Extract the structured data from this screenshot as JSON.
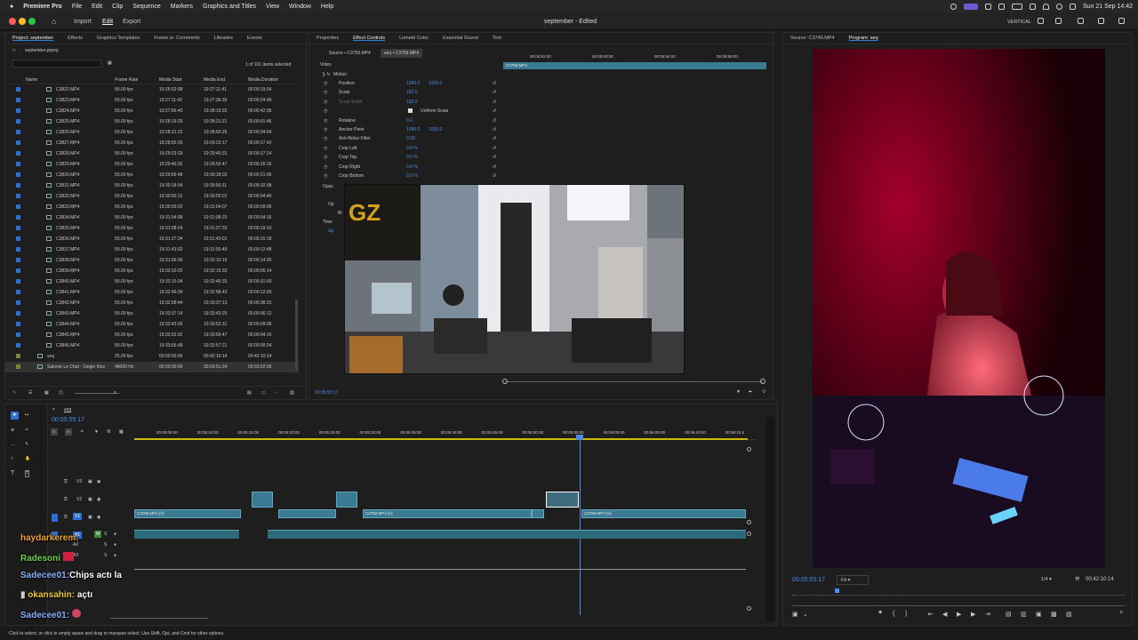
{
  "menubar": {
    "app": "Premiere Pro",
    "items": [
      "File",
      "Edit",
      "Clip",
      "Sequence",
      "Markers",
      "Graphics and Titles",
      "View",
      "Window",
      "Help"
    ],
    "clock": "Sun 21 Sep  14:42"
  },
  "titlebar": {
    "nav": [
      "Import",
      "Edit",
      "Export"
    ],
    "title": "september - Edited",
    "workspace": "VERTICAL"
  },
  "project": {
    "tabs": [
      "Project: september",
      "Effects",
      "Graphics Templates",
      "Frame.io: Comments",
      "Libraries",
      "Events"
    ],
    "filename": "september.prproj",
    "selection_count": "1 of 101 items selected",
    "columns": [
      "Name",
      "Frame Rate",
      "Media Start",
      "Media End",
      "Media Duration"
    ],
    "rows": [
      [
        "C3822.MP4",
        "50.00 fps",
        "19:26:52:08",
        "19:27:11:41",
        "00:00:19:34"
      ],
      [
        "C3823.MP4",
        "50.00 fps",
        "19:27:11:42",
        "19:27:36:39",
        "00:00:24:48"
      ],
      [
        "C3824.MP4",
        "50.00 fps",
        "19:27:56:40",
        "19:28:19:25",
        "00:00:42:36"
      ],
      [
        "C3825.MP4",
        "50.00 fps",
        "19:28:19:26",
        "19:28:21:21",
        "00:00:01:46"
      ],
      [
        "C3826.MP4",
        "50.00 fps",
        "19:28:21:22",
        "19:28:55:25",
        "00:00:34:04"
      ],
      [
        "C3827.MP4",
        "50.00 fps",
        "19:28:55:26",
        "19:29:23:17",
        "00:00:27:42"
      ],
      [
        "C3828.MP4",
        "50.00 fps",
        "19:29:23:18",
        "19:29:40:31",
        "00:00:17:14"
      ],
      [
        "C3829.MP4",
        "50.00 fps",
        "19:29:40:32",
        "19:29:56:47",
        "00:00:16:16"
      ],
      [
        "C3830.MP4",
        "50.00 fps",
        "19:29:56:48",
        "19:30:18:03",
        "00:00:21:06"
      ],
      [
        "C3831.MP4",
        "50.00 fps",
        "19:30:18:04",
        "19:30:50:11",
        "00:00:32:08"
      ],
      [
        "C3832.MP4",
        "50.00 fps",
        "19:30:50:12",
        "19:30:55:01",
        "00:00:04:40"
      ],
      [
        "C3833.MP4",
        "50.00 fps",
        "19:30:55:02",
        "19:31:04:07",
        "00:00:09:06"
      ],
      [
        "C3834.MP4",
        "50.00 fps",
        "19:31:04:08",
        "19:31:08:23",
        "00:00:04:16"
      ],
      [
        "C3835.MP4",
        "50.00 fps",
        "19:31:08:24",
        "19:31:27:33",
        "00:00:19:10"
      ],
      [
        "C3836.MP4",
        "50.00 fps",
        "19:31:27:34",
        "19:31:43:01",
        "00:00:15:18"
      ],
      [
        "C3837.MP4",
        "50.00 fps",
        "19:31:43:02",
        "19:31:55:49",
        "00:00:12:48"
      ],
      [
        "C3838.MP4",
        "50.00 fps",
        "19:31:56:00",
        "19:32:10:19",
        "00:00:14:20"
      ],
      [
        "C3839.MP4",
        "50.00 fps",
        "19:32:10:20",
        "19:32:15:33",
        "00:00:05:14"
      ],
      [
        "C3840.MP4",
        "50.00 fps",
        "19:32:15:34",
        "19:32:46:33",
        "00:00:31:00"
      ],
      [
        "C3841.MP4",
        "50.00 fps",
        "19:32:46:34",
        "19:32:58:43",
        "00:00:12:00"
      ],
      [
        "C3842.MP4",
        "50.00 fps",
        "19:32:58:44",
        "19:33:37:13",
        "00:00:38:20"
      ],
      [
        "C3843.MP4",
        "50.00 fps",
        "19:33:37:14",
        "19:33:43:25",
        "00:00:06:12"
      ],
      [
        "C3844.MP4",
        "50.00 fps",
        "19:33:43:26",
        "19:33:52:31",
        "00:00:09:06"
      ],
      [
        "C3845.MP4",
        "50.00 fps",
        "19:33:52:32",
        "19:33:56:47",
        "00:00:04:16"
      ],
      [
        "C3846.MP4",
        "50.00 fps",
        "19:33:56:48",
        "19:33:57:21",
        "00:00:00:24"
      ],
      [
        "seq",
        "25.00 fps",
        "00:00:00:00",
        "00:42:10:14",
        "00:42:10:14"
      ],
      [
        "Salomé Le Chat - Single Kiss",
        "48000 Hz",
        "00:00:00:00",
        "00:03:51:24",
        "00:03:52:00"
      ]
    ]
  },
  "effect_controls": {
    "tabs": [
      "Properties",
      "Effect Controls",
      "Lumetri Color",
      "Essential Sound",
      "Text"
    ],
    "source_tab": "Source • C3759.MP4",
    "seq_tab": "seq • C3759.MP4",
    "section": "Video",
    "ruler": [
      "00:05:52:00",
      "00:05:53:00",
      "00:05:54:00",
      "00:05:55:00"
    ],
    "clip_label": "C3759.MP4",
    "motion": "Motion",
    "props": [
      {
        "name": "Position",
        "v1": "1080.0",
        "v2": "1920.0"
      },
      {
        "name": "Scale",
        "v1": "100.0",
        "v2": ""
      },
      {
        "name": "Scale Width",
        "v1": "100.0",
        "v2": ""
      },
      {
        "name": "",
        "v1": "Uniform Scale",
        "v2": ""
      },
      {
        "name": "Rotation",
        "v1": "0.0",
        "v2": ""
      },
      {
        "name": "Anchor Point",
        "v1": "1080.0",
        "v2": "1920.0"
      },
      {
        "name": "Anti-flicker Filter",
        "v1": "0.00",
        "v2": ""
      },
      {
        "name": "Crop Left",
        "v1": "0.0 %",
        "v2": ""
      },
      {
        "name": "Crop Top",
        "v1": "0.0 %",
        "v2": ""
      },
      {
        "name": "Crop Right",
        "v1": "0.0 %",
        "v2": ""
      },
      {
        "name": "Crop Bottom",
        "v1": "0.0 %",
        "v2": ""
      }
    ],
    "partial_rows": [
      "Opac",
      "Op",
      "Bl",
      "Time",
      "Sp"
    ],
    "timecode": "00:05:55:17"
  },
  "program": {
    "tabs": [
      "Source: C3749.MP4",
      "Program: seq"
    ],
    "timecode": "00:05:55:17",
    "fit": "Fit",
    "quality": "1/4",
    "duration": "00:42:10:14"
  },
  "timeline": {
    "seq_tab": "seq",
    "timecode": "00:05:55:17",
    "ruler": [
      "00:05:05:00",
      "00:05:10:00",
      "00:05:15:00",
      "00:05:20:00",
      "00:05:25:00",
      "00:05:30:00",
      "00:05:35:00",
      "00:05:40:00",
      "00:05:45:00",
      "00:05:50:00",
      "00:05:55:00",
      "00:06:00:00",
      "00:06:05:00",
      "00:06:10:00",
      "00:06:15:0"
    ],
    "tracks": [
      "V3",
      "V2",
      "V1",
      "A1",
      "A2",
      "A3"
    ],
    "clips_v1": [
      "C3758.MP4 [V]",
      "C3758.MP4 [V]",
      "C3759.MP4 [V]"
    ]
  },
  "chat": [
    {
      "user": "haydarkerem:",
      "msg": "",
      "color": "#f0a030"
    },
    {
      "user": "Radesoni",
      "msg": "",
      "color": "#6cd44a"
    },
    {
      "user": "Sadecee01:",
      "msg": "Chips actı la",
      "color": "#8ab0ff"
    },
    {
      "user": "okansahin:",
      "msg": "açtı",
      "color": "#f0c93b"
    },
    {
      "user": "Sadecee01:",
      "msg": "",
      "color": "#8ab0ff"
    }
  ],
  "status": "Click to select, or click in empty space and drag to marquee select. Use Shift, Opt, and Cmd for other options."
}
